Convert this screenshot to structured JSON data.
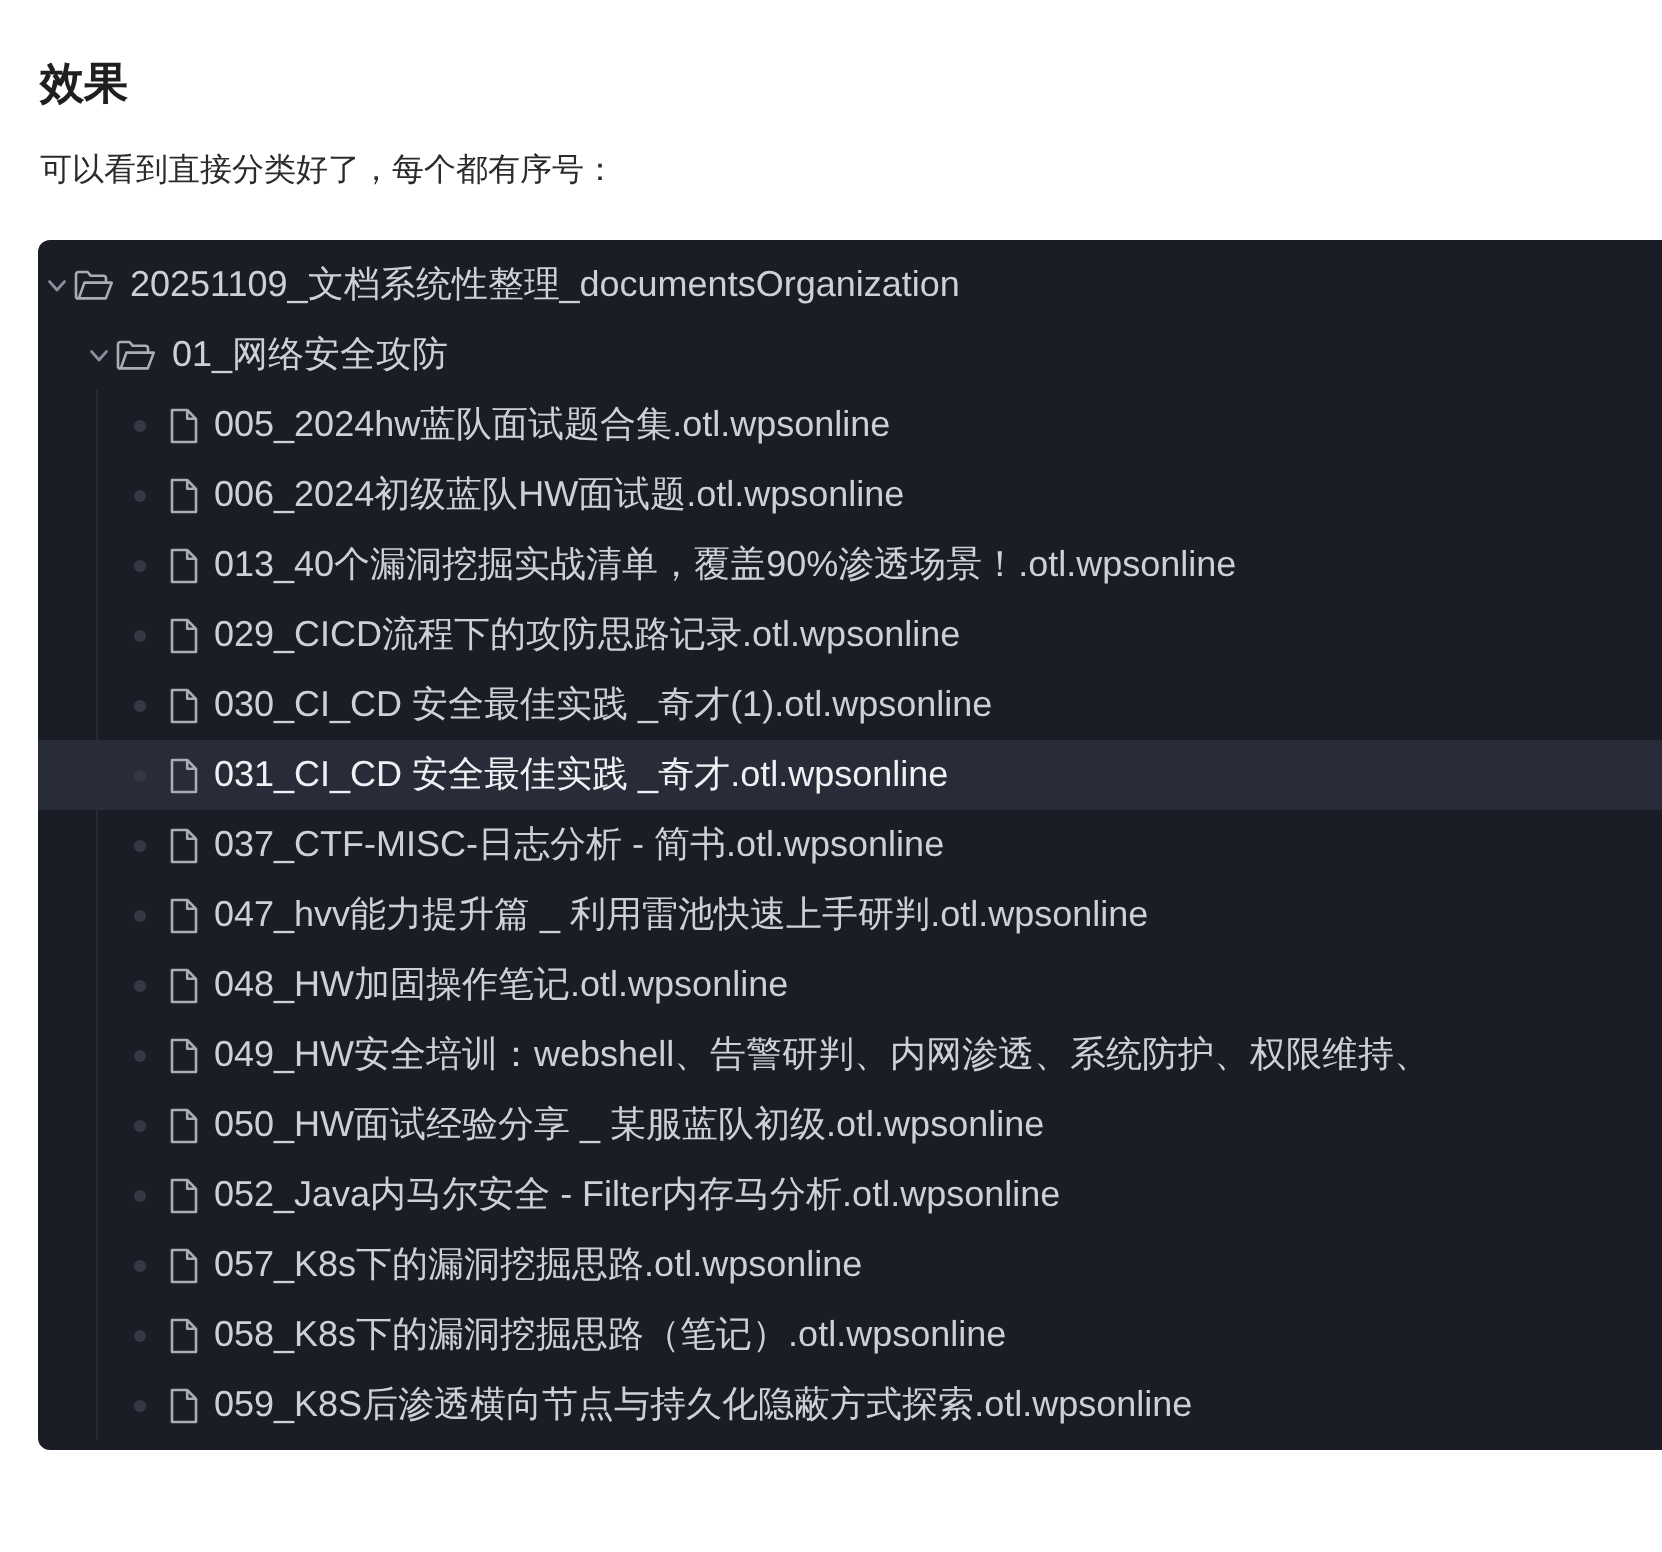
{
  "heading": "效果",
  "intro": "可以看到直接分类好了，每个都有序号：",
  "tree": [
    {
      "kind": "folder",
      "label": "20251109_文档系统性整理_documentsOrganization",
      "expanded": true,
      "selected": false,
      "children": [
        {
          "kind": "folder",
          "label": "01_网络安全攻防",
          "expanded": true,
          "selected": false,
          "children": [
            {
              "kind": "file",
              "label": "005_2024hw蓝队面试题合集.otl.wpsonline",
              "selected": false
            },
            {
              "kind": "file",
              "label": "006_2024初级蓝队HW面试题.otl.wpsonline",
              "selected": false
            },
            {
              "kind": "file",
              "label": "013_40个漏洞挖掘实战清单，覆盖90%渗透场景！.otl.wpsonline",
              "selected": false
            },
            {
              "kind": "file",
              "label": "029_CICD流程下的攻防思路记录.otl.wpsonline",
              "selected": false
            },
            {
              "kind": "file",
              "label": "030_CI_CD 安全最佳实践 _奇才(1).otl.wpsonline",
              "selected": false
            },
            {
              "kind": "file",
              "label": "031_CI_CD 安全最佳实践 _奇才.otl.wpsonline",
              "selected": true
            },
            {
              "kind": "file",
              "label": "037_CTF-MISC-日志分析 - 简书.otl.wpsonline",
              "selected": false
            },
            {
              "kind": "file",
              "label": "047_hvv能力提升篇 _ 利用雷池快速上手研判.otl.wpsonline",
              "selected": false
            },
            {
              "kind": "file",
              "label": "048_HW加固操作笔记.otl.wpsonline",
              "selected": false
            },
            {
              "kind": "file",
              "label": "049_HW安全培训：webshell、告警研判、内网渗透、系统防护、权限维持、",
              "selected": false
            },
            {
              "kind": "file",
              "label": "050_HW面试经验分享 _ 某服蓝队初级.otl.wpsonline",
              "selected": false
            },
            {
              "kind": "file",
              "label": "052_Java内马尔安全 - Filter内存马分析.otl.wpsonline",
              "selected": false
            },
            {
              "kind": "file",
              "label": "057_K8s下的漏洞挖掘思路.otl.wpsonline",
              "selected": false
            },
            {
              "kind": "file",
              "label": "058_K8s下的漏洞挖掘思路（笔记）.otl.wpsonline",
              "selected": false
            },
            {
              "kind": "file",
              "label": "059_K8S后渗透横向节点与持久化隐蔽方式探索.otl.wpsonline",
              "selected": false
            }
          ]
        }
      ]
    }
  ]
}
